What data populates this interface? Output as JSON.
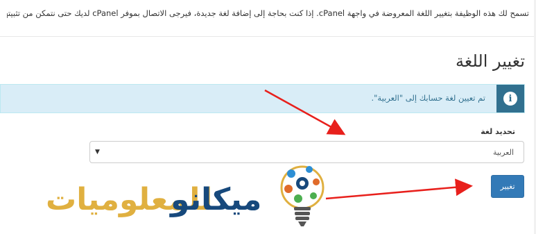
{
  "intro_text": "تسمح لك هذه الوظيفة بتغيير اللغة المعروضة في واجهة cPanel. إذا كنت بحاجة إلى إضافة لغة جديدة، فيرجى الاتصال بموفر cPanel لديك حتى نتمكن من تثبيتها.",
  "page_title": "تغيير اللغة",
  "alert": {
    "icon": "info-icon",
    "message": "تم تعيين لغة حسابك إلى \"العربية\"."
  },
  "language_select": {
    "label": "تحديد لغة",
    "selected": "العربية",
    "arrow": "▼"
  },
  "change_button": "تغيير",
  "watermark": {
    "text_blue": "ميكانو",
    "text_gold": "للمعلوميات"
  },
  "colors": {
    "alert_bg": "#d9edf7",
    "alert_icon_bg": "#31708f",
    "button": "#337ab7",
    "arrow": "#e8201c",
    "logo_blue": "#17497c",
    "logo_gold": "#e0b040"
  }
}
